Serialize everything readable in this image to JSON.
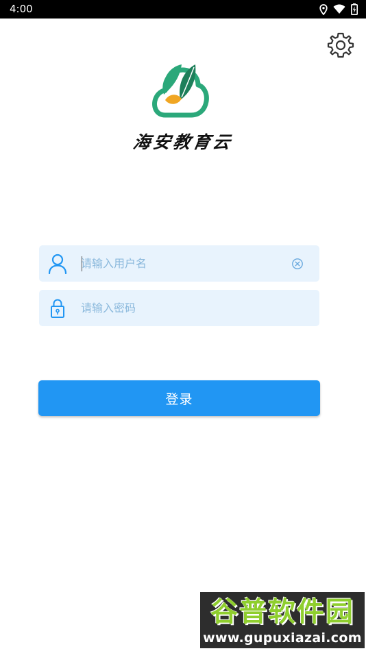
{
  "status_bar": {
    "time": "4:00",
    "icons": [
      "location-icon",
      "wifi-icon",
      "battery-charging-icon"
    ]
  },
  "header": {
    "settings_icon": "gear-icon"
  },
  "app": {
    "name": "海安教育云",
    "logo_colors": {
      "green": "#2ba87a",
      "dark_green": "#1d7f5a",
      "orange": "#f0a623"
    }
  },
  "login_form": {
    "username": {
      "placeholder": "请输入用户名",
      "value": "",
      "icon": "user-icon",
      "clear_icon": "clear-icon"
    },
    "password": {
      "placeholder": "请输入密码",
      "value": "",
      "icon": "lock-icon"
    },
    "submit_label": "登录"
  },
  "colors": {
    "accent": "#2196f3",
    "field_background": "#e8f3fd",
    "placeholder": "#8ab8dc"
  },
  "watermark": {
    "title": "谷普软件园",
    "url": "www.gupuxiazai.com"
  }
}
